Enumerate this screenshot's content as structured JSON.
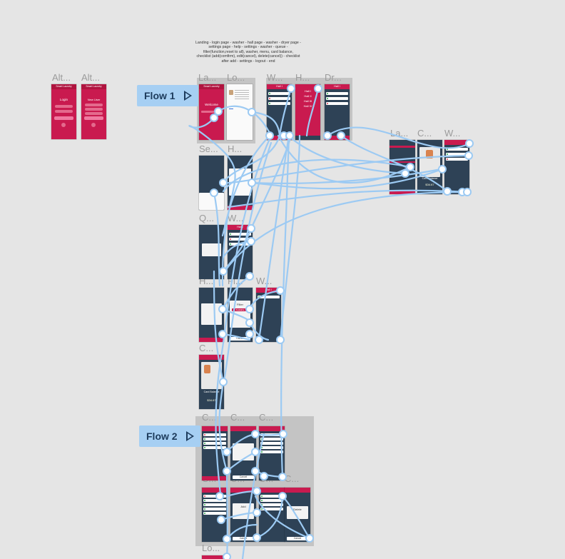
{
  "annotation": {
    "lines": [
      "Landing - login page - washer - hall page - washer -  dryer page -",
      "settings page - help - settings - washer - queue -",
      "filter(function,reset to all), washer, menu, card balance,",
      "checklist (add(comfirm), edit(cancel), delete(cancel)) - checklist",
      "after add - settings - logout - end"
    ]
  },
  "flows": [
    {
      "name": "Flow 1",
      "icon": "play-icon"
    },
    {
      "name": "Flow 2",
      "icon": "play-icon"
    }
  ],
  "frame_labels": {
    "alt1": "Alt...",
    "alt2": "Alt...",
    "la1": "La...",
    "lo1": "Lo...",
    "w1": "W...",
    "h1": "H...",
    "dr1": "Dr...",
    "la2": "La...",
    "c1": "C...",
    "w2": "W...",
    "se": "Se...",
    "he": "H...",
    "q": "Q...",
    "w3": "W...",
    "h2": "H...",
    "fi": "Fi...",
    "w4": "W...",
    "c2": "C...",
    "f2c1": "C...",
    "f2c2": "C...",
    "f2c3": "C...",
    "f2c4": "C...",
    "f2c5": "C...",
    "f2c6": "C...",
    "f2c7": "C...",
    "lo2": "Lo..."
  },
  "screens": {
    "app_name": "Smart Laundry",
    "login_title": "Login",
    "new_user": "New User",
    "welcome": "Welcome",
    "hall": "Hall I",
    "hall_items": [
      "Hall I",
      "Hall II",
      "Hall III",
      "Hall IV"
    ],
    "card_balance": "Card Balance",
    "balance_value": "$34.67",
    "filter_title": "Filter",
    "available": "Available",
    "cancel": "Cancel",
    "add": "Add",
    "delete": "Delete"
  },
  "colors": {
    "canvas": "#e5e5e5",
    "section": "#c4c4c4",
    "flow_tag": "#a6cff3",
    "app_red": "#c91a4f",
    "app_navy": "#2e4256",
    "connector": "#9ccaf3"
  }
}
